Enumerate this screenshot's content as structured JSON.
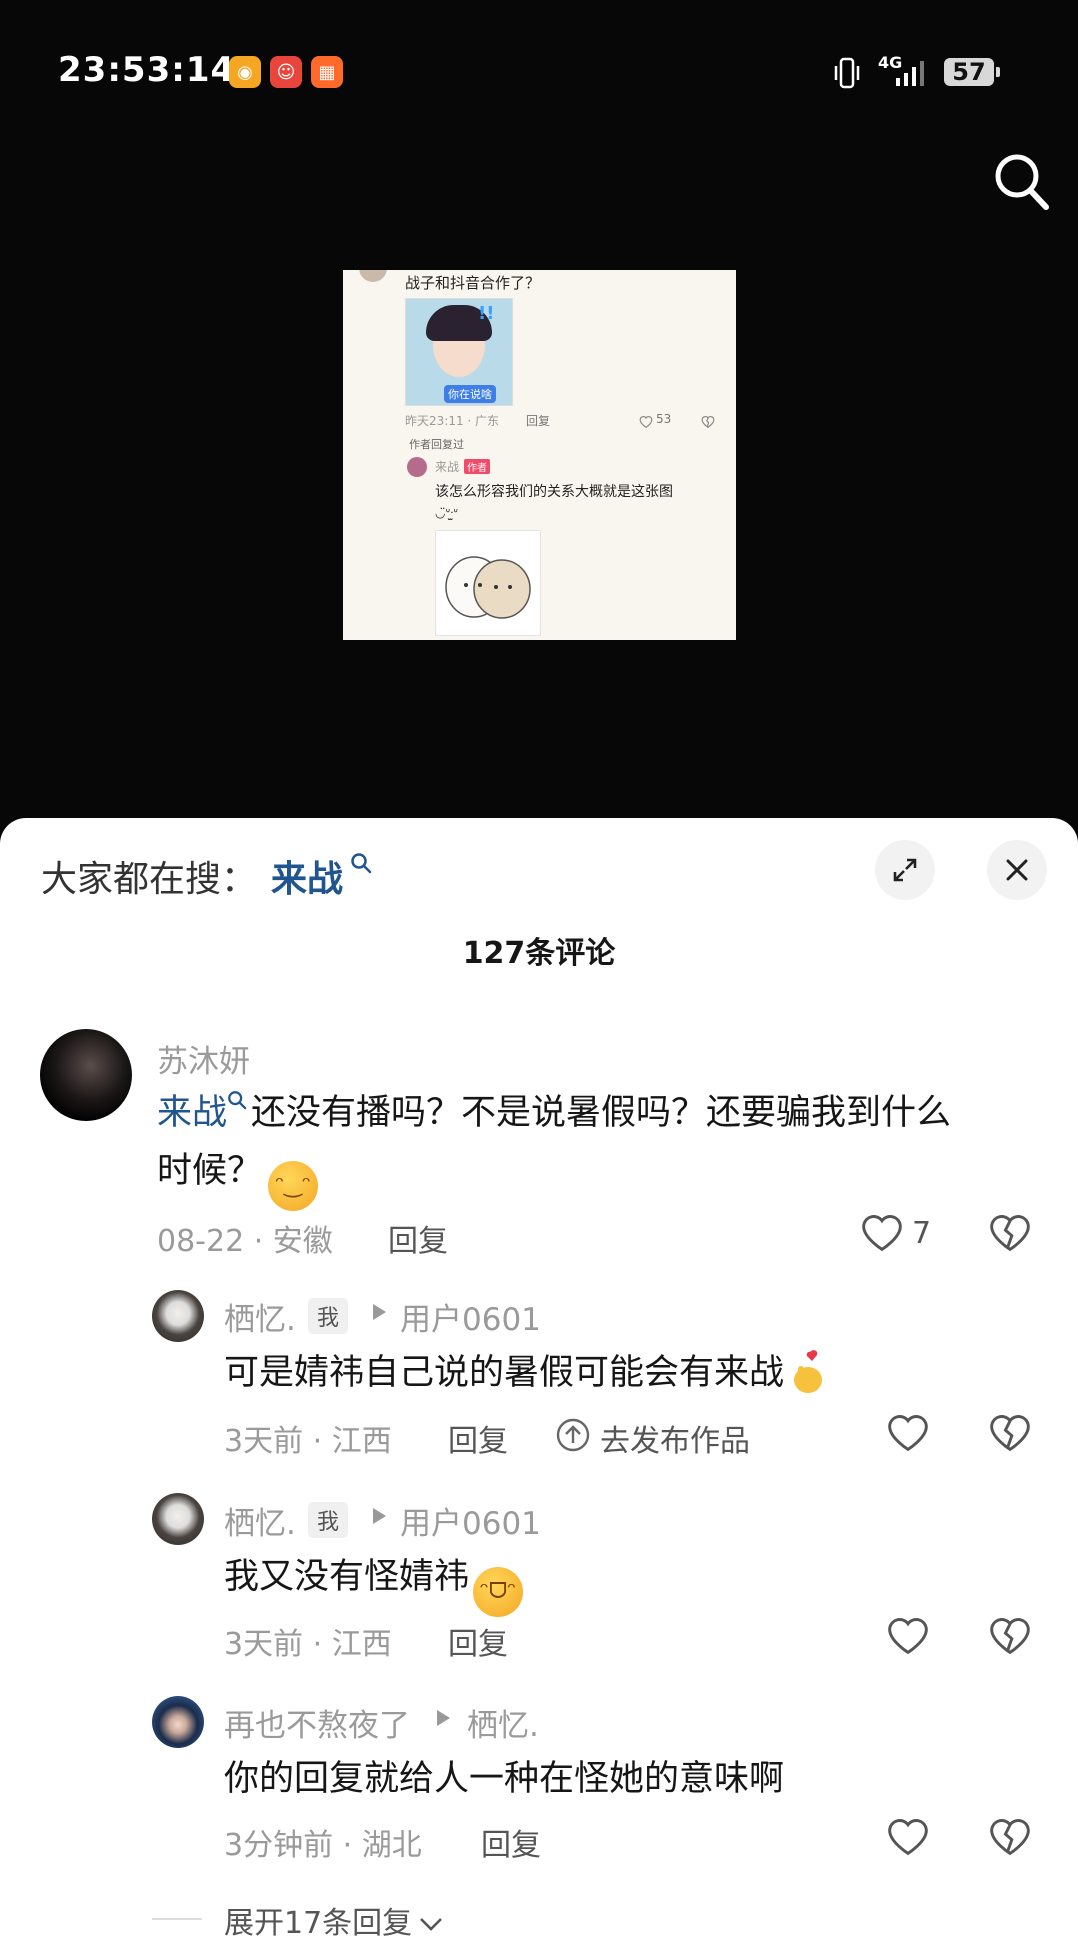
{
  "status_bar": {
    "time": "23:53:14",
    "network": "4G",
    "battery": "57",
    "app_icons": [
      "weibo-icon",
      "app-icon-red",
      "app-icon-orange"
    ]
  },
  "embedded_screenshot": {
    "question": "战子和抖音合作了？",
    "sticker_text": "你在说啥",
    "meta": "昨天23:11 · 广东",
    "reply": "回复",
    "likes": "53",
    "author_replied": "作者回复过",
    "author_name": "来战",
    "author_tag": "作者",
    "author_text": "该怎么形容我们的关系大概就是这张图",
    "kaomoji": "◡̈ᐡᐧ̫ᐡ"
  },
  "sheet": {
    "search_prefix": "大家都在搜：",
    "search_term": "来战",
    "comment_count": "127条评论"
  },
  "comments": [
    {
      "user": "苏沐妍",
      "link": "来战",
      "text_line1": "还没有播吗？不是说暑假吗？还要骗我到什么",
      "text_line2": "时候？",
      "meta": "08-22 · 安徽",
      "reply": "回复",
      "likes": "7"
    }
  ],
  "replies": [
    {
      "user": "栖忆.",
      "me_tag": "我",
      "target": "用户0601",
      "text": "可是婧祎自己说的暑假可能会有来战",
      "meta": "3天前 · 江西",
      "reply": "回复",
      "publish": "去发布作品"
    },
    {
      "user": "栖忆.",
      "me_tag": "我",
      "target": "用户0601",
      "text": "我又没有怪婧祎",
      "meta": "3天前 · 江西",
      "reply": "回复"
    },
    {
      "user": "再也不熬夜了",
      "target": "栖忆.",
      "text": "你的回复就给人一种在怪她的意味啊",
      "meta": "3分钟前 · 湖北",
      "reply": "回复"
    }
  ],
  "expand": "展开17条回复"
}
